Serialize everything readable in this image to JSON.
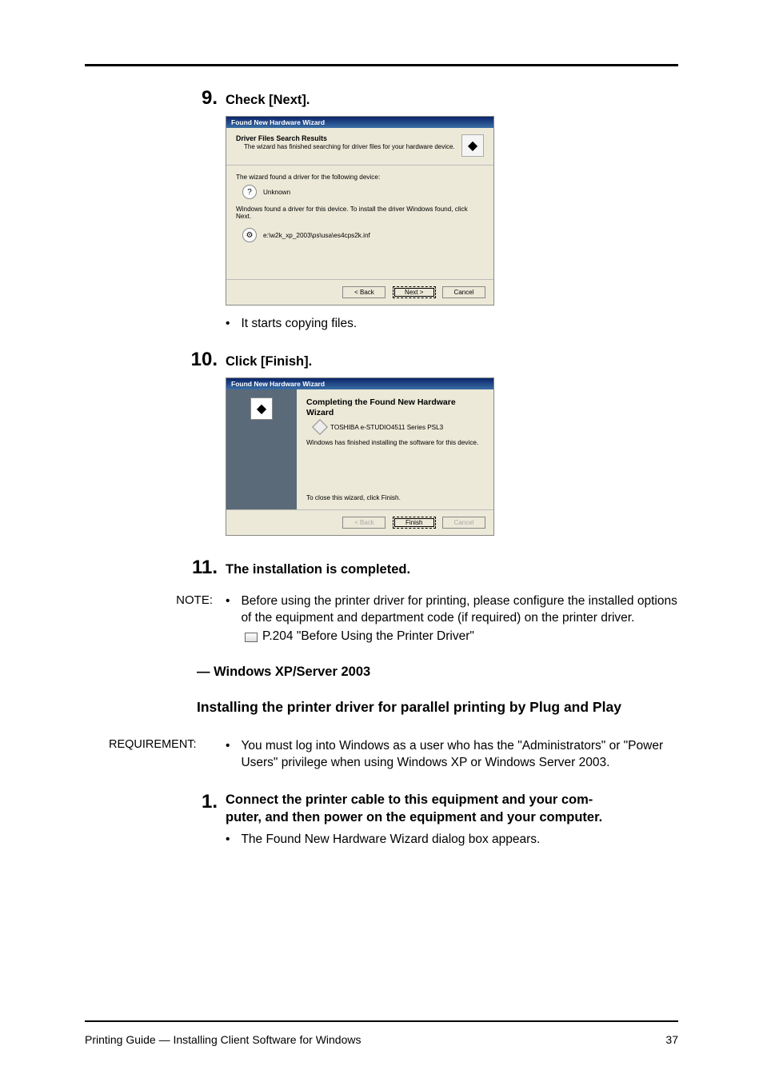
{
  "steps": {
    "s9": {
      "num": "9.",
      "text": "Check [Next]."
    },
    "s10": {
      "num": "10.",
      "text": "Click [Finish]."
    },
    "s11": {
      "num": "11.",
      "text": "The installation is completed."
    },
    "s1": {
      "num": "1.",
      "line1": "Connect the printer cable to this equipment and your com-",
      "line2": "puter, and then power on the equipment and your computer."
    }
  },
  "dialog1": {
    "title": "Found New Hardware Wizard",
    "head_bold": "Driver Files Search Results",
    "head_sub": "The wizard has finished searching for driver files for your hardware device.",
    "line1": "The wizard found a driver for the following device:",
    "device": "Unknown",
    "line2": "Windows found a driver for this device. To install the driver Windows found, click Next.",
    "path": "e:\\w2k_xp_2003\\ps\\usa\\es4cps2k.inf",
    "btn_back": "< Back",
    "btn_next": "Next >",
    "btn_cancel": "Cancel"
  },
  "dialog2": {
    "title": "Found New Hardware Wizard",
    "heading": "Completing the Found New Hardware Wizard",
    "device": "TOSHIBA e-STUDIO4511 Series PSL3",
    "msg": "Windows has finished installing the software for this device.",
    "closing": "To close this wizard, click Finish.",
    "btn_back": "< Back",
    "btn_finish": "Finish",
    "btn_cancel": "Cancel"
  },
  "bullets": {
    "copying": "It starts copying files.",
    "step1_sub": "The Found New Hardware Wizard dialog box appears."
  },
  "note": {
    "label": "NOTE:",
    "text1": "Before using the printer driver for printing, please configure the installed options of the equipment and department code (if required) on the printer driver.",
    "ref": "P.204 \"Before Using the Printer Driver\""
  },
  "section": {
    "h": "— Windows XP/Server 2003",
    "sub": "Installing the printer driver for parallel printing by Plug and Play"
  },
  "requirement": {
    "label": "REQUIREMENT:",
    "text": "You must log into Windows as a user who has the \"Administrators\" or \"Power Users\" privilege when using Windows XP or Windows Server 2003."
  },
  "footer": {
    "left": "Printing Guide — Installing Client Software for Windows",
    "right": "37"
  }
}
